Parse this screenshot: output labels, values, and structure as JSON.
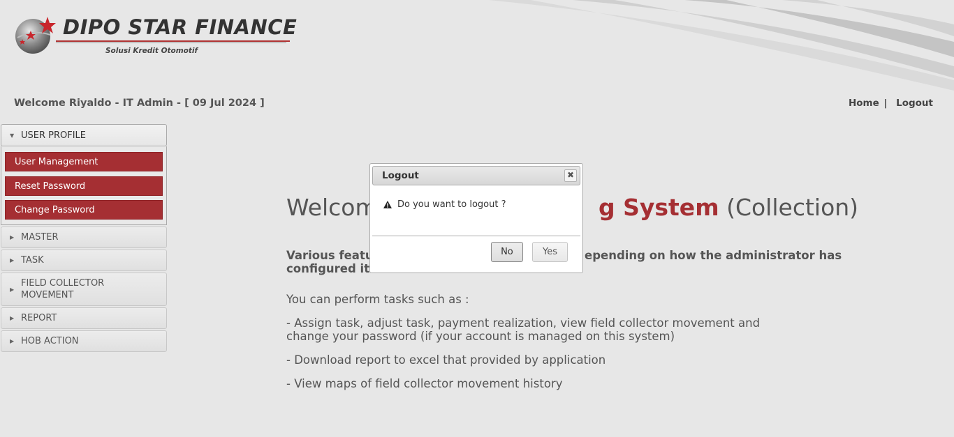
{
  "brand": {
    "name": "DIPO STAR FINANCE",
    "tagline": "Solusi Kredit Otomotif",
    "accent_color": "#a52f33"
  },
  "header": {
    "welcome": "Welcome Riyaldo - IT Admin - [ 09 Jul 2024 ]",
    "nav": {
      "home": "Home",
      "separator": "|",
      "logout": "Logout"
    }
  },
  "sidebar": {
    "sections": [
      {
        "label": "USER PROFILE",
        "expanded": true,
        "items": [
          "User Management",
          "Reset Password",
          "Change Password"
        ]
      },
      {
        "label": "MASTER",
        "expanded": false
      },
      {
        "label": "TASK",
        "expanded": false
      },
      {
        "label": "FIELD COLLECTOR MOVEMENT",
        "label_line1": "FIELD COLLECTOR",
        "label_line2": "MOVEMENT",
        "expanded": false
      },
      {
        "label": "REPORT",
        "expanded": false
      },
      {
        "label": "HOB ACTION",
        "expanded": false
      }
    ]
  },
  "main": {
    "heading_visible_left": "Welcom",
    "heading_visible_bold": "g System",
    "heading_visible_tail": " (Collection)",
    "features_visible_left": "Various featu",
    "features_visible_right": "epending on how the administrator has",
    "features_line2": "configured it",
    "tasks_intro": "You can perform tasks such as :",
    "task_1_line1": "- Assign task, adjust task, payment realization, view field collector movement and",
    "task_1_line2": "change your password (if your account is managed on this system)",
    "task_2": "- Download report to excel that provided by application",
    "task_3": "- View maps of field collector movement history"
  },
  "dialog": {
    "title": "Logout",
    "close_icon": "close-icon",
    "message": "Do you want to logout ?",
    "warning_icon": "warning-icon",
    "no_label": "No",
    "yes_label": "Yes"
  }
}
